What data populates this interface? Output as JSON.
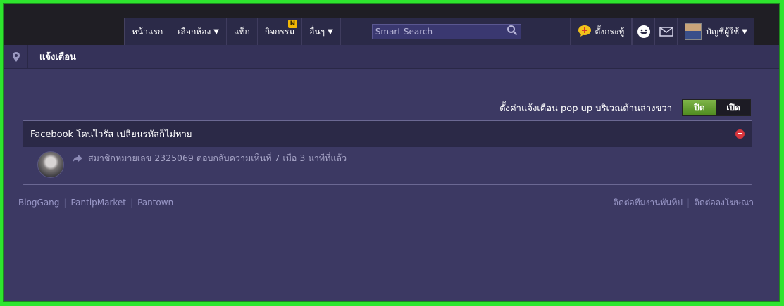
{
  "nav": {
    "home": "หน้าแรก",
    "rooms": "เลือกห้อง",
    "tags": "แท็ก",
    "activities": "กิจกรรม",
    "activities_badge": "N",
    "more": "อื่นๆ"
  },
  "search": {
    "placeholder": "Smart Search"
  },
  "topic": {
    "label": "ตั้งกระทู้"
  },
  "account": {
    "label": "บัญชีผู้ใช้"
  },
  "page": {
    "title": "แจ้งเตือน"
  },
  "popup_setting": {
    "label": "ตั้งค่าแจ้งเตือน pop up บริเวณด้านล่างขวา",
    "off": "ปิด",
    "on": "เปิด"
  },
  "notification": {
    "title": "Facebook โดนไวรัส เปลี่ยนรหัสก็ไม่หาย",
    "text": "สมาชิกหมายเลข 2325069 ตอบกลับความเห็นที่ 7 เมื่อ 3 นาทีที่แล้ว"
  },
  "footer": {
    "left": [
      "BlogGang",
      "PantipMarket",
      "Pantown"
    ],
    "right": [
      "ติดต่อทีมงานพันทิป",
      "ติดต่อลงโฆษณา"
    ]
  },
  "colors": {
    "page_bg": "#3c3963",
    "toggle_active": "#5e9a2b",
    "remove_icon": "#d8353d",
    "badge": "#f2b705"
  }
}
